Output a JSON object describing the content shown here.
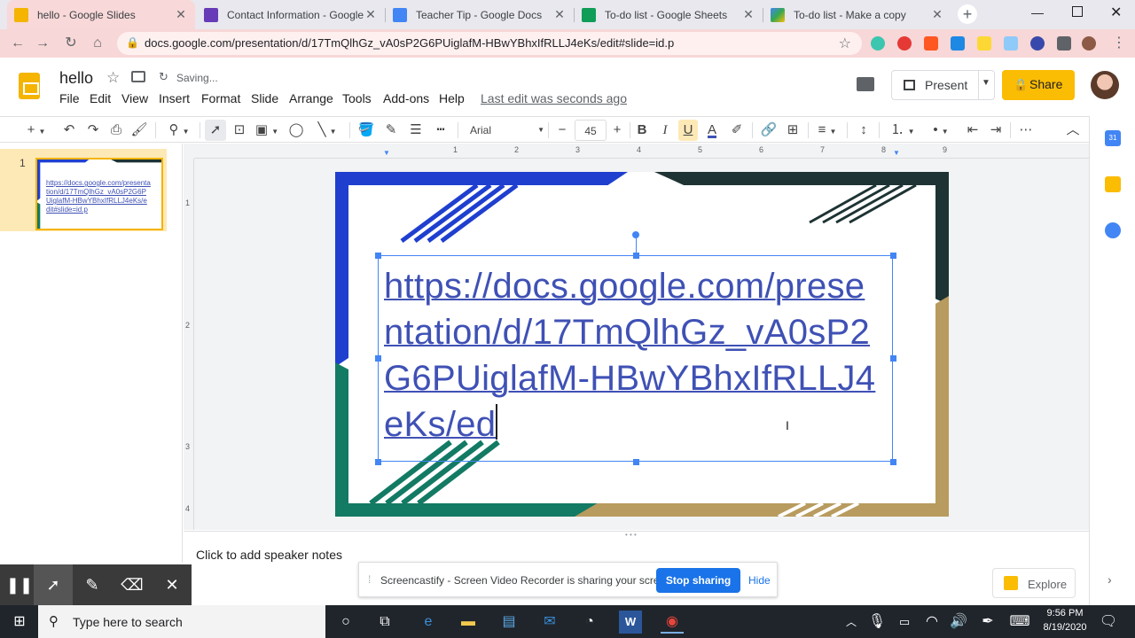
{
  "browser": {
    "tabs": [
      {
        "title": "hello - Google Slides",
        "color": "#f4b400",
        "active": true
      },
      {
        "title": "Contact Information - Google",
        "color": "#673ab7",
        "active": false
      },
      {
        "title": "Teacher Tip - Google Docs",
        "color": "#4285f4",
        "active": false
      },
      {
        "title": "To-do list - Google Sheets",
        "color": "#0f9d58",
        "active": false
      },
      {
        "title": "To-do list - Make a copy",
        "color": "#34a853",
        "active": false
      }
    ],
    "url": "docs.google.com/presentation/d/17TmQlhGz_vA0sP2G6PUiglafM-HBwYBhxIfRLLJ4eKs/edit#slide=id.p"
  },
  "app": {
    "doc_title": "hello",
    "status": "Saving...",
    "menus": [
      "File",
      "Edit",
      "View",
      "Insert",
      "Format",
      "Slide",
      "Arrange",
      "Tools",
      "Add-ons",
      "Help"
    ],
    "last_edit": "Last edit was seconds ago",
    "present_label": "Present",
    "share_label": "Share"
  },
  "toolbar": {
    "font": "Arial",
    "font_size": "45"
  },
  "filmstrip": {
    "slide_number": "1",
    "thumb_text": "https://docs.google.com/presentation/d/17TmQlhGz_vA0sP2G6PUiglafM-HBwYBhxIfRLLJ4eKs/edit#slide=id.p"
  },
  "slide": {
    "text": "https://docs.google.com/presentation/d/17TmQlhGz_vA0sP2G6PUiglafM-HBwYBhxIfRLLJ4eKs/ed"
  },
  "ruler": {
    "h_ticks": [
      "1",
      "2",
      "3",
      "4",
      "5",
      "6",
      "7",
      "8",
      "9"
    ],
    "v_ticks": [
      "1",
      "2",
      "3",
      "4"
    ]
  },
  "notes": {
    "placeholder": "Click to add speaker notes"
  },
  "explore_label": "Explore",
  "screencastify": {
    "message": "Screencastify - Screen Video Recorder is sharing your screen.",
    "stop_label": "Stop sharing",
    "hide_label": "Hide"
  },
  "taskbar": {
    "search_placeholder": "Type here to search",
    "time": "9:56 PM",
    "date": "8/19/2020"
  }
}
